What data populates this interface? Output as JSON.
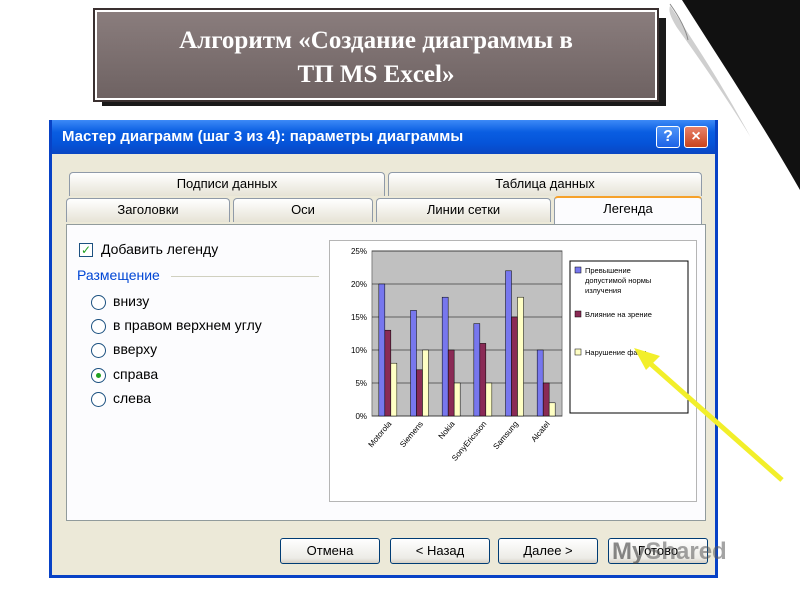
{
  "slide": {
    "title_line1": "Алгоритм «Создание диаграммы в",
    "title_line2": "ТП MS Excel»"
  },
  "window": {
    "title": "Мастер диаграмм (шаг 3 из 4): параметры диаграммы",
    "help_icon": "?",
    "close_icon": "×"
  },
  "tabs": {
    "row1": [
      "Подписи данных",
      "Таблица данных"
    ],
    "row2": [
      "Заголовки",
      "Оси",
      "Линии сетки",
      "Легенда"
    ],
    "active": "Легенда"
  },
  "legend_options": {
    "add_legend_label": "Добавить легенду",
    "add_legend_checked": true,
    "placement_label": "Размещение",
    "placements": [
      "внизу",
      "в правом верхнем углу",
      "вверху",
      "справа",
      "слева"
    ],
    "selected_placement": "справа"
  },
  "chart_data": {
    "type": "bar",
    "categories": [
      "Motorola",
      "Siemens",
      "Nokia",
      "SonyEricsson",
      "Samsung",
      "Alcatel"
    ],
    "series": [
      {
        "name": "Превышение допустимой нормы излучения",
        "values": [
          20,
          16,
          18,
          14,
          22,
          10
        ],
        "color": "#7777ee"
      },
      {
        "name": "Влияние на зрение",
        "values": [
          13,
          7,
          10,
          11,
          15,
          5
        ],
        "color": "#8a2a55"
      },
      {
        "name": "Нарушение фазы",
        "values": [
          8,
          10,
          5,
          5,
          18,
          2
        ],
        "color": "#ffffc4"
      }
    ],
    "yticks": [
      "0%",
      "5%",
      "10%",
      "15%",
      "20%",
      "25%"
    ],
    "ylim": [
      0,
      25
    ],
    "legend_placement": "right",
    "plot_background": "#c0c0c0",
    "grid": true
  },
  "buttons": {
    "cancel": "Отмена",
    "back": "< Назад",
    "next": "Далее >",
    "finish": "Готово"
  },
  "watermark": {
    "prefix": "My",
    "suffix": "Shared"
  },
  "colors": {
    "titlebar": "#0a5ee2",
    "dialog_bg": "#ece9d8",
    "arrow": "#f2ef2a"
  }
}
